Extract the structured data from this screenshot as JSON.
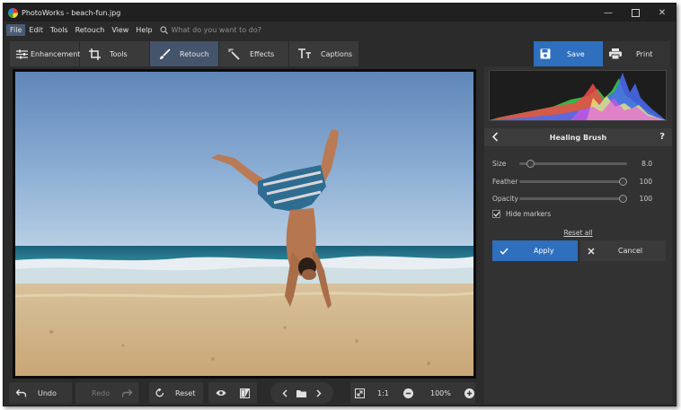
{
  "window": {
    "title": "PhotoWorks - beach-fun.jpg"
  },
  "menu": {
    "items": [
      {
        "label": "File",
        "active": true
      },
      {
        "label": "Edit"
      },
      {
        "label": "Tools"
      },
      {
        "label": "Retouch"
      },
      {
        "label": "View"
      },
      {
        "label": "Help"
      }
    ],
    "search_placeholder": "What do you want to do?"
  },
  "tabs": [
    {
      "label": "Enhancement",
      "icon": "sliders-icon"
    },
    {
      "label": "Tools",
      "icon": "crop-icon"
    },
    {
      "label": "Retouch",
      "icon": "brush-icon",
      "active": true
    },
    {
      "label": "Effects",
      "icon": "magic-wand-icon"
    },
    {
      "label": "Captions",
      "icon": "text-icon"
    }
  ],
  "actions": {
    "save_label": "Save",
    "print_label": "Print"
  },
  "panel": {
    "title": "Healing Brush",
    "help": "?",
    "sliders": [
      {
        "label": "Size",
        "value": "8.0",
        "fraction": 0.08
      },
      {
        "label": "Feather",
        "value": "100",
        "fraction": 1.0
      },
      {
        "label": "Opacity",
        "value": "100",
        "fraction": 1.0
      }
    ],
    "hide_markers_label": "Hide markers",
    "hide_markers_checked": true,
    "reset_all_label": "Reset all",
    "apply_label": "Apply",
    "cancel_label": "Cancel"
  },
  "bottom": {
    "undo_label": "Undo",
    "redo_label": "Redo",
    "reset_label": "Reset",
    "ratio_label": "1:1",
    "zoom_label": "100%"
  },
  "colors": {
    "accent": "#2e6fbe",
    "active_tab": "#44546b",
    "background": "#2b2b2b",
    "panel": "#323232"
  }
}
